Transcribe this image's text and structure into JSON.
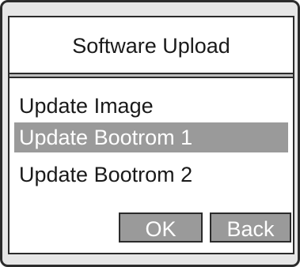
{
  "dialog": {
    "title": "Software Upload"
  },
  "menu": {
    "items": [
      {
        "label": "Update Image",
        "selected": false
      },
      {
        "label": "Update Bootrom 1",
        "selected": true
      },
      {
        "label": "Update Bootrom 2",
        "selected": false
      }
    ]
  },
  "buttons": {
    "ok_label": "OK",
    "back_label": "Back"
  },
  "colors": {
    "selection": "#9a9a9a",
    "frame": "#2b2b2b",
    "bezel": "#e6e6e6"
  }
}
